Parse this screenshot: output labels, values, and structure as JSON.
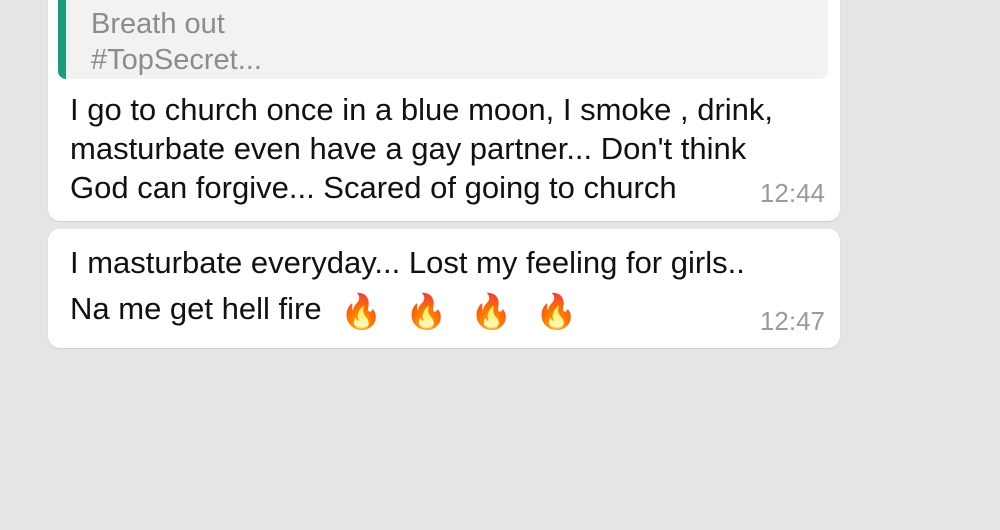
{
  "messages": [
    {
      "quote_lines": [
        "Breath out",
        "#TopSecret..."
      ],
      "text_lines": [
        "I go to church once in a blue moon, I smoke , drink,",
        "masturbate even have a gay partner... Don't think",
        "God can forgive... Scared of going to church"
      ],
      "time": "12:44"
    },
    {
      "text_lines": [
        "I masturbate everyday... Lost my feeling for girls..",
        "Na me get hell fire"
      ],
      "emojis": [
        "🔥",
        "🔥",
        "🔥",
        "🔥"
      ],
      "time": "12:47"
    }
  ],
  "colors": {
    "chat_background": "#e5e5e5",
    "bubble_background": "#ffffff",
    "quote_bar": "#1a9c7e",
    "quote_background": "#f2f2f2",
    "timestamp": "#9a9a9a"
  }
}
